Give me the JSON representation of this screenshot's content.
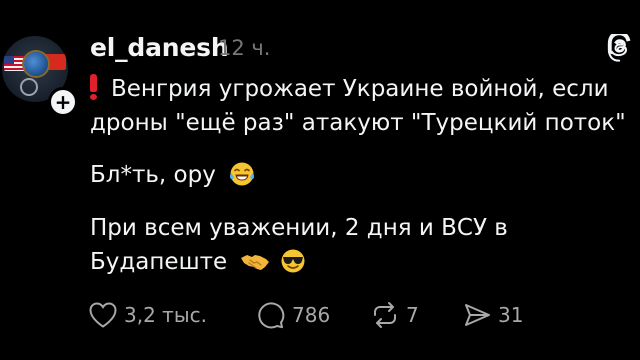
{
  "post": {
    "username": "el_danesh",
    "time": "12 ч.",
    "line1": "Венгрия угрожает Украине войной, если",
    "line2": "дроны \"ещё раз\" атакуют \"Турецкий поток\"",
    "line3": "Бл*ть, ору",
    "line4": "При всем уважении, 2 дня и ВСУ в",
    "line5": "Будапеште"
  },
  "icons": {
    "exclamation": "exclamation-icon",
    "laugh": "tears-of-joy-emoji",
    "handshake": "handshake-emoji",
    "sunglasses": "sunglasses-emoji",
    "threads": "threads-logo-icon",
    "follow": "plus-icon"
  },
  "actions": {
    "likes": "3,2 тыс.",
    "comments": "786",
    "reposts": "7",
    "shares": "31"
  },
  "colors": {
    "background": "#000000",
    "text": "#f3f5f7",
    "muted": "#777777",
    "action": "#a8a8a8",
    "alert_red": "#e0202a"
  }
}
